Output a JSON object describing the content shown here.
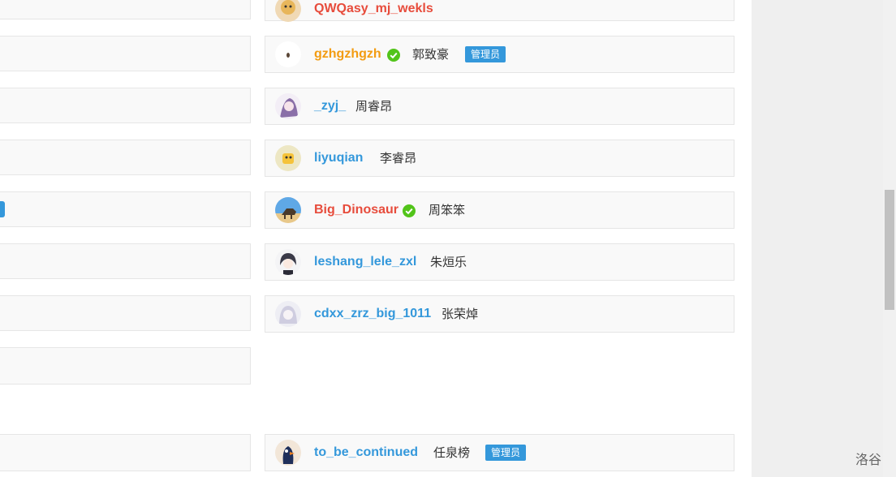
{
  "colors": {
    "red_user": "#e74c3c",
    "orange_user": "#f39c11",
    "blue_user": "#3498db",
    "verified_green": "#52c41a",
    "admin_badge_bg": "#3498db"
  },
  "users": [
    {
      "username": "QWQasy_mj_wekls",
      "realname": "",
      "name_color": "red",
      "verified": false,
      "admin": false
    },
    {
      "username": "gzhgzhgzh",
      "realname": "郭致豪",
      "name_color": "orange",
      "verified": true,
      "admin": true
    },
    {
      "username": "_zyj_",
      "realname": "周睿昂",
      "name_color": "blue",
      "verified": false,
      "admin": false
    },
    {
      "username": "liyuqian",
      "realname": "李睿昂",
      "name_color": "blue",
      "verified": false,
      "admin": false
    },
    {
      "username": "Big_Dinosaur",
      "realname": "周笨笨",
      "name_color": "red",
      "verified": true,
      "admin": false
    },
    {
      "username": "leshang_lele_zxl",
      "realname": "朱烜乐",
      "name_color": "blue",
      "verified": false,
      "admin": false
    },
    {
      "username": "cdxx_zrz_big_1011",
      "realname": "张荣焯",
      "name_color": "blue",
      "verified": false,
      "admin": false
    },
    {
      "username": "to_be_continued",
      "realname": "任泉榜",
      "name_color": "blue",
      "verified": false,
      "admin": true
    }
  ],
  "admin_label": "管理员",
  "brand": "洛谷"
}
